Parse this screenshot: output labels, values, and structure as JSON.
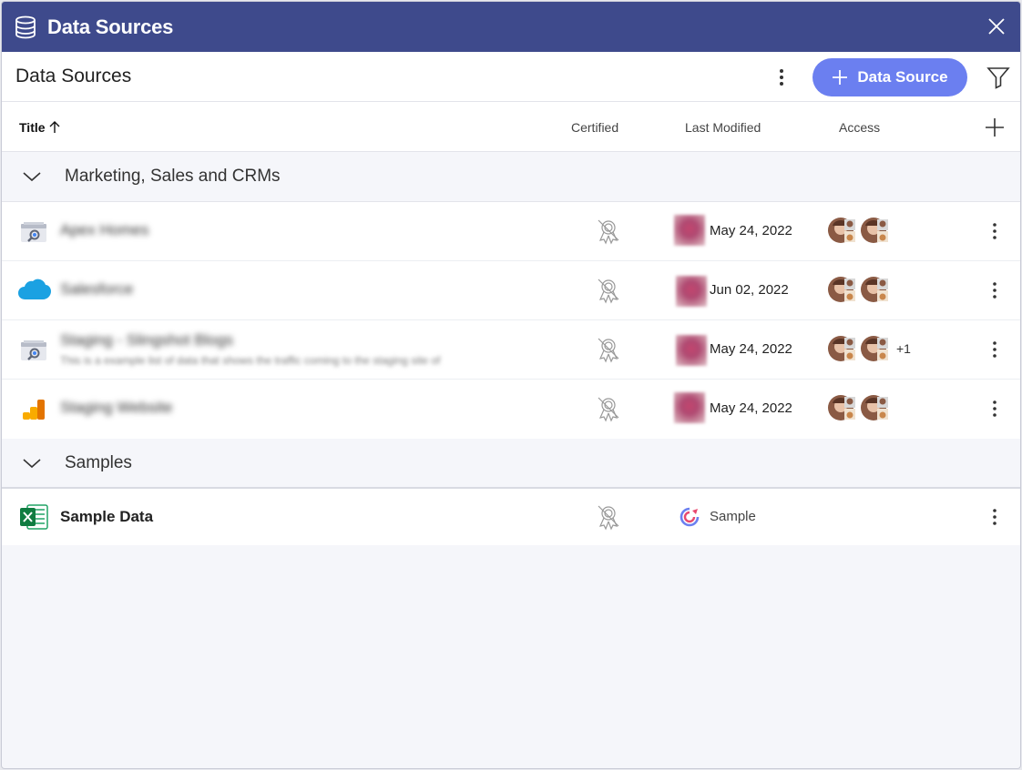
{
  "window": {
    "title": "Data Sources",
    "title_color": "#3e4a8c"
  },
  "header": {
    "title": "Data Sources",
    "add_button_label": "Data Source",
    "accent": "#6b7ff0"
  },
  "columns": {
    "title": "Title",
    "certified": "Certified",
    "last_modified": "Last Modified",
    "access": "Access"
  },
  "groups": [
    {
      "name": "Marketing, Sales and CRMs",
      "rows": [
        {
          "icon": "google-search-console-icon",
          "name": "Apex Homes",
          "description": "",
          "date": "May 24, 2022",
          "extra_access": ""
        },
        {
          "icon": "salesforce-cloud-icon",
          "name": "Salesforce",
          "description": "",
          "date": "Jun 02, 2022",
          "extra_access": ""
        },
        {
          "icon": "google-search-console-icon",
          "name": "Staging - Slingshot Blogs",
          "description": "This is a example list of data that shows the traffic coming to the staging site of",
          "date": "May 24, 2022",
          "extra_access": "+1"
        },
        {
          "icon": "google-analytics-icon",
          "name": "Staging Website",
          "description": "",
          "date": "May 24, 2022",
          "extra_access": ""
        }
      ]
    },
    {
      "name": "Samples",
      "rows": [
        {
          "icon": "excel-icon",
          "name": "Sample Data",
          "label": "Sample"
        }
      ]
    }
  ]
}
